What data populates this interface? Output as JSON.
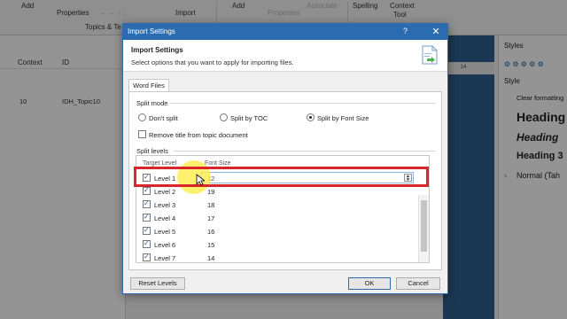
{
  "ribbon": {
    "add1": "Add",
    "properties1": "Properties",
    "import": "Import",
    "topics_group": "Topics & Te",
    "add2": "Add",
    "properties2": "Properties",
    "associate": "Associate",
    "spelling": "Spelling",
    "context_tool": "Context",
    "context_tool2": "Tool",
    "pin_marker": "ᵃ"
  },
  "left_pane": {
    "col_context": "Context",
    "col_id": "ID",
    "row_context": "10",
    "row_id": "IDH_Topic10"
  },
  "editor": {
    "ruler_text": "· 14 ·"
  },
  "styles_pane": {
    "title": "Styles",
    "style_label": "Style",
    "clear_formatting": "Clear formatting",
    "heading1": "Heading",
    "heading2": "Heading",
    "heading3": "Heading 3",
    "normal": "Normal (Tah"
  },
  "dialog": {
    "title": "Import Settings",
    "help": "?",
    "close": "✕",
    "header_title": "Import Settings",
    "header_subtitle": "Select options that you want to apply for importing files.",
    "tab_label": "Word Files",
    "split_mode_label": "Split mode",
    "opt_dont_split": "Don't split",
    "opt_split_toc": "Split by TOC",
    "opt_split_font": "Split by Font Size",
    "remove_title_label": "Remove title from topic document",
    "split_levels_label": "Split levels",
    "col_target_level": "Target Level",
    "col_font_size": "Font Size",
    "levels": [
      {
        "name": "Level 1",
        "size": "12"
      },
      {
        "name": "Level 2",
        "size": "19"
      },
      {
        "name": "Level 3",
        "size": "18"
      },
      {
        "name": "Level 4",
        "size": "17"
      },
      {
        "name": "Level 5",
        "size": "16"
      },
      {
        "name": "Level 6",
        "size": "15"
      },
      {
        "name": "Level 7",
        "size": "14"
      }
    ],
    "reset_levels": "Reset Levels",
    "ok": "OK",
    "cancel": "Cancel"
  },
  "colors": {
    "titlebar": "#2b6cb0",
    "highlight": "#d9262c",
    "cursor_glow": "#ffec3c",
    "blue_strip": "#2f5f8f"
  }
}
